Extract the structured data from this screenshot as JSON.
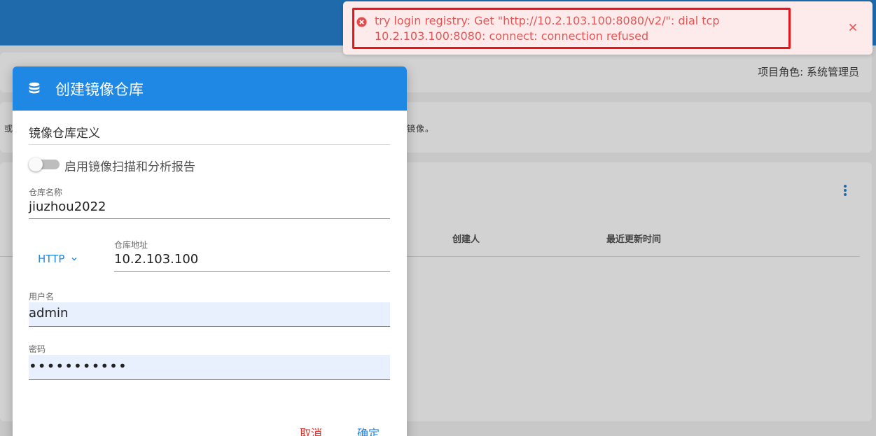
{
  "background": {
    "project_role": "项目角色: 系统管理员",
    "left_fragment": "或",
    "right_fragment": "镜像。",
    "table_columns": [
      "创建人",
      "最近更新时间"
    ]
  },
  "dialog": {
    "title": "创建镜像仓库",
    "icon": "database-icon",
    "section_title": "镜像仓库定义",
    "scan_toggle": {
      "label": "启用镜像扫描和分析报告",
      "enabled": false
    },
    "fields": {
      "name": {
        "label": "仓库名称",
        "value": "jiuzhou2022"
      },
      "protocol": {
        "value": "HTTP"
      },
      "address": {
        "label": "仓库地址",
        "value": "10.2.103.100"
      },
      "username": {
        "label": "用户名",
        "value": "admin"
      },
      "password": {
        "label": "密码",
        "value": "•••••••••••"
      }
    },
    "buttons": {
      "cancel": "取消",
      "confirm": "确定"
    }
  },
  "toast": {
    "message": "try login registry: Get \"http://10.2.103.100:8080/v2/\": dial tcp 10.2.103.100:8080: connect: connection refused",
    "type": "error"
  },
  "colors": {
    "topbar": "#1e6aab",
    "dialog_header": "#1f88e5",
    "toast_bg": "#fdeaea",
    "toast_text": "#e45656",
    "highlight": "#e8141a",
    "cancel": "#e53935",
    "confirm": "#1f88e5"
  }
}
